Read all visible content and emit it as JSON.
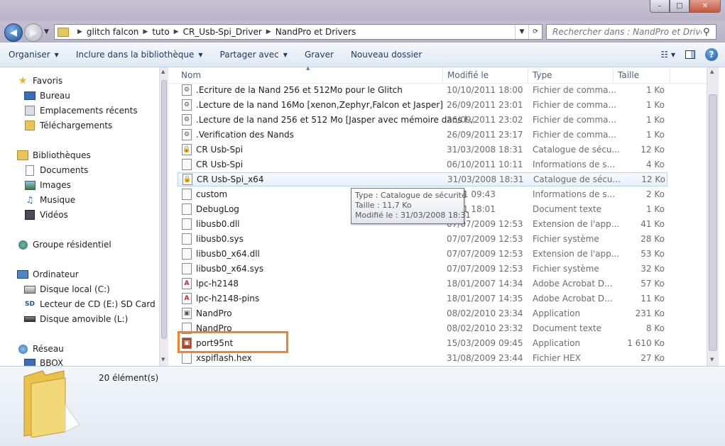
{
  "window": {
    "buttons": {
      "minimize": "–",
      "maximize": "□",
      "close": "✕"
    }
  },
  "address": {
    "breadcrumbs": [
      "glitch falcon",
      "tuto",
      "CR_Usb-Spi_Driver",
      "NandPro et Drivers"
    ],
    "refresh_icon": "refresh-icon"
  },
  "search": {
    "placeholder": "Rechercher dans : NandPro et Drivers"
  },
  "toolbar": {
    "organize": "Organiser",
    "include": "Inclure dans la bibliothèque",
    "share": "Partager avec",
    "burn": "Graver",
    "new_folder": "Nouveau dossier",
    "help": "?"
  },
  "sidebar": {
    "favorites": "Favoris",
    "desktop": "Bureau",
    "recent": "Emplacements récents",
    "downloads": "Téléchargements",
    "libraries": "Bibliothèques",
    "documents": "Documents",
    "images": "Images",
    "music": "Musique",
    "videos": "Vidéos",
    "homegroup": "Groupe résidentiel",
    "computer": "Ordinateur",
    "disk_c": "Disque local (C:)",
    "cd_e": "Lecteur de CD (E:) SD Card",
    "removable_l": "Disque amovible (L:)",
    "network": "Réseau",
    "bbox": "BBOX"
  },
  "columns": {
    "name": "Nom",
    "modified": "Modifié le",
    "type": "Type",
    "size": "Taille"
  },
  "files": [
    {
      "name": ".Ecriture de la Nand 256 et 512Mo pour le Glitch",
      "date": "10/10/2011 18:00",
      "type": "Fichier de comma...",
      "size": "1 Ko"
    },
    {
      "name": ".Lecture de la nand 16Mo [xenon,Zephyr,Falcon et Jasper]",
      "date": "26/09/2011 23:01",
      "type": "Fichier de comma...",
      "size": "1 Ko"
    },
    {
      "name": ".Lecture de la nand 256 et 512 Mo [Jasper avec mémoire dans l...",
      "date": "26/09/2011 23:02",
      "type": "Fichier de comma...",
      "size": "1 Ko"
    },
    {
      "name": ".Verification des Nands",
      "date": "26/09/2011 23:17",
      "type": "Fichier de comma...",
      "size": "1 Ko"
    },
    {
      "name": "CR Usb-Spi",
      "date": "31/03/2008 18:31",
      "type": "Catalogue de sécu...",
      "size": "12 Ko"
    },
    {
      "name": "CR Usb-Spi",
      "date": "06/10/2011 10:11",
      "type": "Informations de s...",
      "size": "4 Ko"
    },
    {
      "name": "CR Usb-Spi_x64",
      "date": "31/03/2008 18:31",
      "type": "Catalogue de sécu...",
      "size": "12 Ko"
    },
    {
      "name": "custom",
      "date": "2011 09:43",
      "type": "Informations de s...",
      "size": "2 Ko"
    },
    {
      "name": "DebugLog",
      "date": "2011 18:01",
      "type": "Document texte",
      "size": "1 Ko"
    },
    {
      "name": "libusb0.dll",
      "date": "07/07/2009 12:53",
      "type": "Extension de l'app...",
      "size": "41 Ko"
    },
    {
      "name": "libusb0.sys",
      "date": "07/07/2009 12:53",
      "type": "Fichier système",
      "size": "28 Ko"
    },
    {
      "name": "libusb0_x64.dll",
      "date": "07/07/2009 12:53",
      "type": "Extension de l'app...",
      "size": "53 Ko"
    },
    {
      "name": "libusb0_x64.sys",
      "date": "07/07/2009 12:53",
      "type": "Fichier système",
      "size": "32 Ko"
    },
    {
      "name": "lpc-h2148",
      "date": "18/01/2007 14:34",
      "type": "Adobe Acrobat D...",
      "size": "57 Ko"
    },
    {
      "name": "lpc-h2148-pins",
      "date": "18/01/2007 14:35",
      "type": "Adobe Acrobat D...",
      "size": "11 Ko"
    },
    {
      "name": "NandPro",
      "date": "08/02/2010 23:34",
      "type": "Application",
      "size": "231 Ko"
    },
    {
      "name": "NandPro",
      "date": "08/02/2010 23:32",
      "type": "Document texte",
      "size": "8 Ko"
    },
    {
      "name": "port95nt",
      "date": "15/03/2009 09:45",
      "type": "Application",
      "size": "1 610 Ko"
    },
    {
      "name": "xspiflash.hex",
      "date": "31/08/2009 23:44",
      "type": "Fichier HEX",
      "size": "27 Ko"
    }
  ],
  "tooltip": {
    "type": "Type : Catalogue de sécurité",
    "size": "Taille : 11,7 Ko",
    "modified": "Modifié le : 31/03/2008 18:31"
  },
  "status": {
    "count": "20 élément(s)"
  },
  "colors": {
    "highlight": "#f5822a",
    "selection": "#e6f1fb",
    "toolbar_text": "#1e395b"
  }
}
